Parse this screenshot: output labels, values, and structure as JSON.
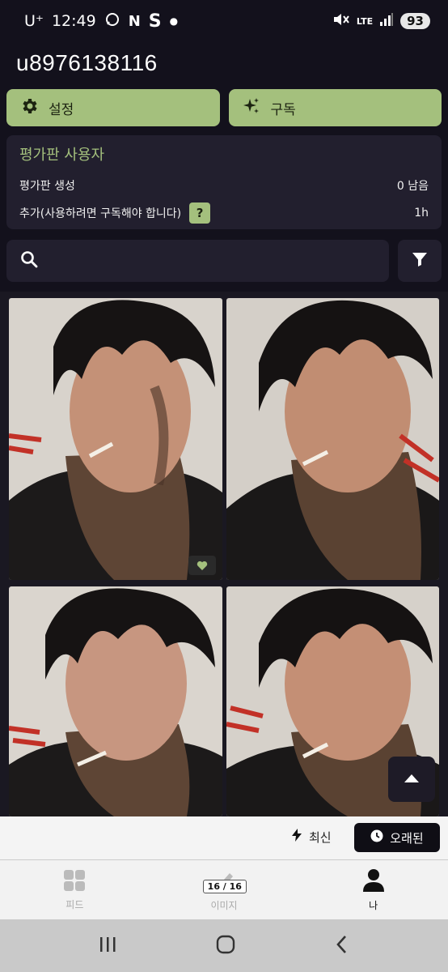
{
  "status": {
    "carrier": "U⁺",
    "time": "12:49",
    "network": "LTE",
    "battery": "93"
  },
  "profile": {
    "username": "u8976138116"
  },
  "actions": {
    "settings_label": "설정",
    "subscribe_label": "구독"
  },
  "trial": {
    "title": "평가판 사용자",
    "create_label": "평가판 생성",
    "create_value": "0 남음",
    "extra_label": "추가(사용하려면 구독해야 합니다)",
    "help_label": "?",
    "extra_value": "1h"
  },
  "search": {
    "placeholder": ""
  },
  "sort": {
    "newest_label": "최신",
    "oldest_label": "오래된"
  },
  "nav": {
    "feed_label": "피드",
    "images_label": "이미지",
    "images_count": "16 / 16",
    "me_label": "나"
  },
  "colors": {
    "accent": "#a4c07d",
    "background": "#13111c",
    "card": "#221f2e"
  }
}
